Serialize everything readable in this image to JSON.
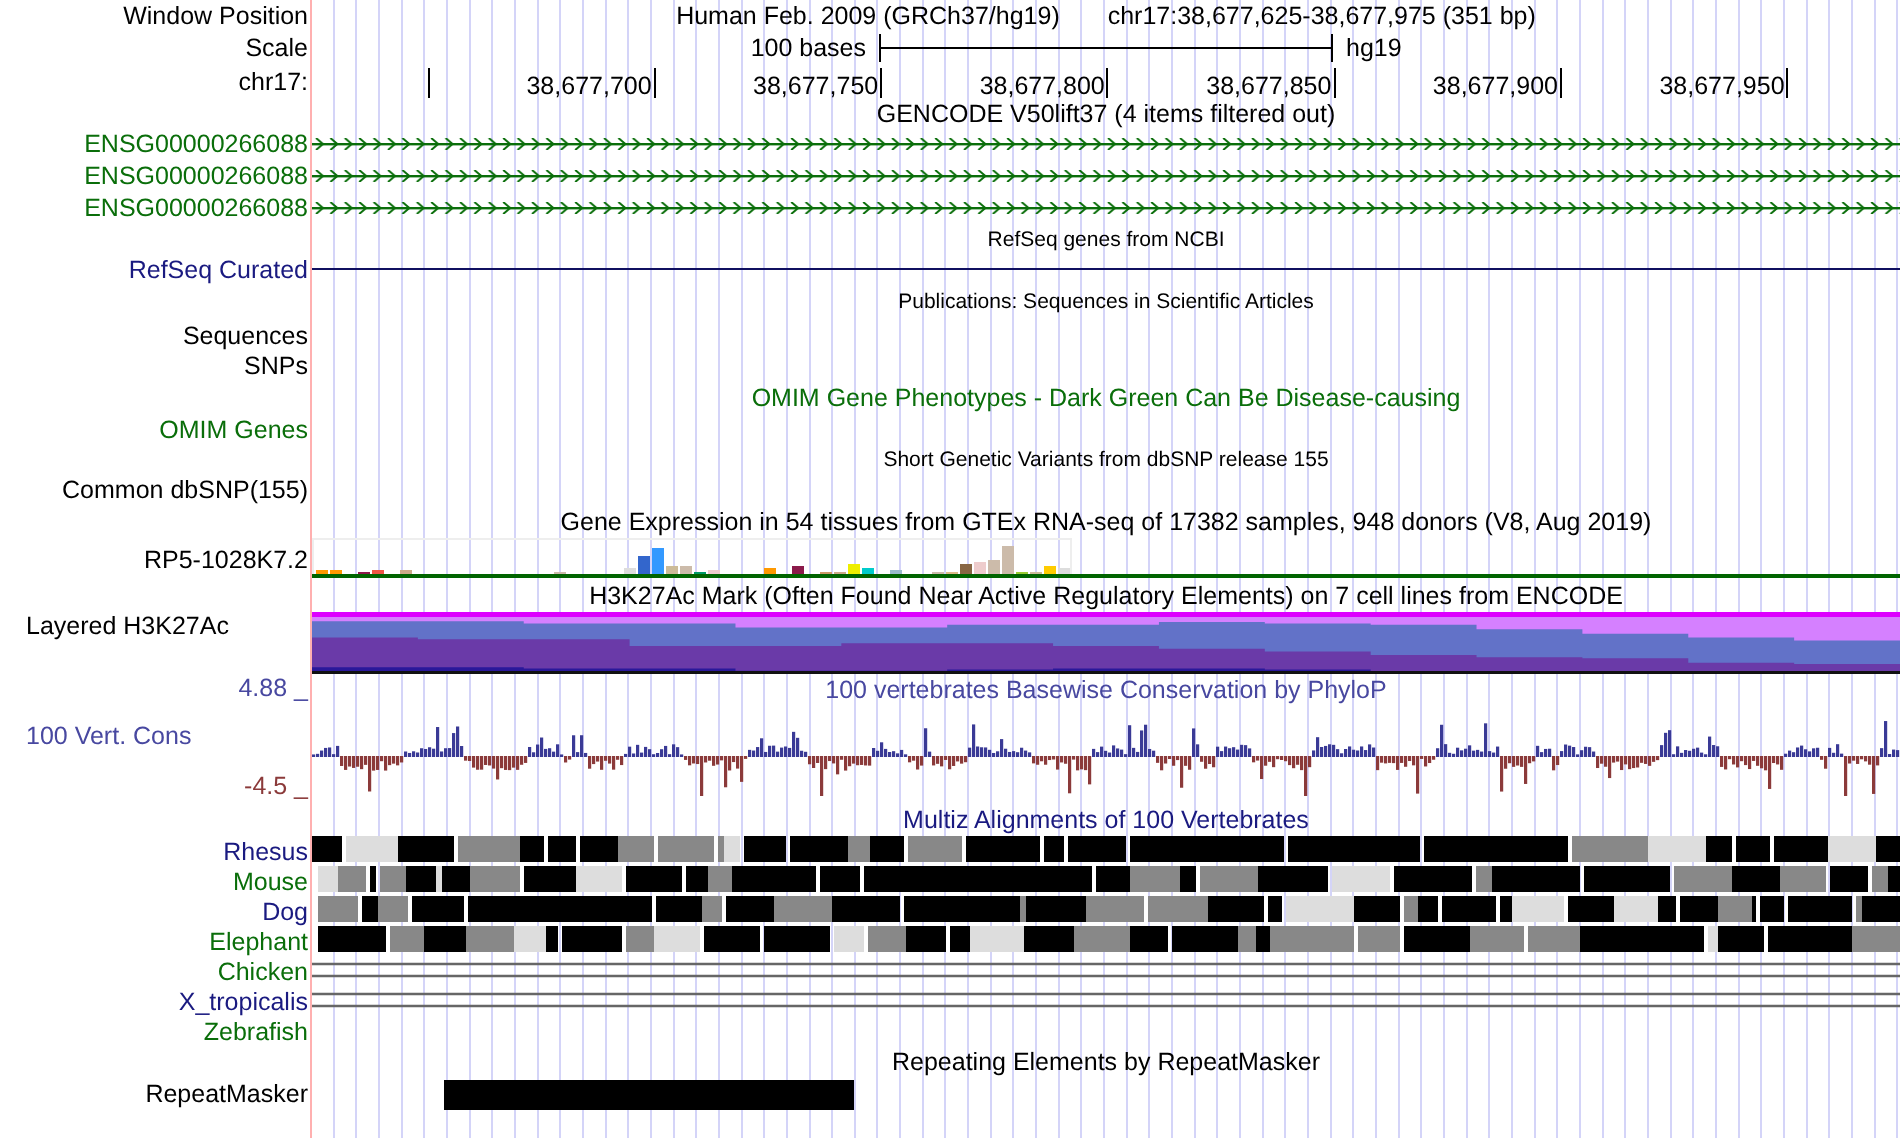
{
  "header": {
    "position_label": "Window Position",
    "assembly": "Human Feb. 2009 (GRCh37/hg19)",
    "position": "chr17:38,677,625-38,677,975 (351 bp)",
    "scale_label": "Scale",
    "scale_text": "100 bases",
    "scale_db": "hg19",
    "chrom_label": "chr17:",
    "ticks": [
      "38,677,700",
      "38,677,750",
      "38,677,800",
      "38,677,850",
      "38,677,900",
      "38,677,950"
    ]
  },
  "gencode": {
    "title": "GENCODE V50lift37 (4 items filtered out)",
    "items": [
      {
        "name": "ENSG00000266088"
      },
      {
        "name": "ENSG00000266088"
      },
      {
        "name": "ENSG00000266088"
      }
    ]
  },
  "refseq": {
    "title": "RefSeq genes from NCBI",
    "label": "RefSeq Curated"
  },
  "publications": {
    "title": "Publications: Sequences in Scientific Articles",
    "labels": [
      "Sequences",
      "SNPs"
    ]
  },
  "omim": {
    "title": "OMIM Gene Phenotypes - Dark Green Can Be Disease-causing",
    "label": "OMIM Genes"
  },
  "dbsnp": {
    "title": "Short Genetic Variants from dbSNP release 155",
    "label": "Common dbSNP(155)"
  },
  "gtex": {
    "title": "Gene Expression in 54 tissues from GTEx RNA-seq of 17382 samples, 948 donors (V8, Aug 2019)",
    "label": "RP5-1028K7.2"
  },
  "h3k27ac": {
    "title": "H3K27Ac Mark (Often Found Near Active Regulatory Elements) on 7 cell lines from ENCODE",
    "label": "Layered H3K27Ac"
  },
  "conservation": {
    "title": "100 vertebrates Basewise Conservation by PhyloP",
    "label": "100 Vert. Cons",
    "max": "4.88 _",
    "min": "-4.5 _"
  },
  "multiz": {
    "title": "Multiz Alignments of 100 Vertebrates",
    "species": [
      {
        "name": "Rhesus",
        "color": "#1a1a80",
        "kind": "blocks"
      },
      {
        "name": "Mouse",
        "color": "#0a6e0a",
        "kind": "blocks"
      },
      {
        "name": "Dog",
        "color": "#1a1a80",
        "kind": "blocks"
      },
      {
        "name": "Elephant",
        "color": "#0a6e0a",
        "kind": "blocks"
      },
      {
        "name": "Chicken",
        "color": "#0a6e0a",
        "kind": "lines"
      },
      {
        "name": "X_tropicalis",
        "color": "#1a1a80",
        "kind": "lines"
      },
      {
        "name": "Zebrafish",
        "color": "#0a6e0a",
        "kind": "none"
      }
    ]
  },
  "repeatmasker": {
    "title": "Repeating Elements by RepeatMasker",
    "label": "RepeatMasker"
  }
}
